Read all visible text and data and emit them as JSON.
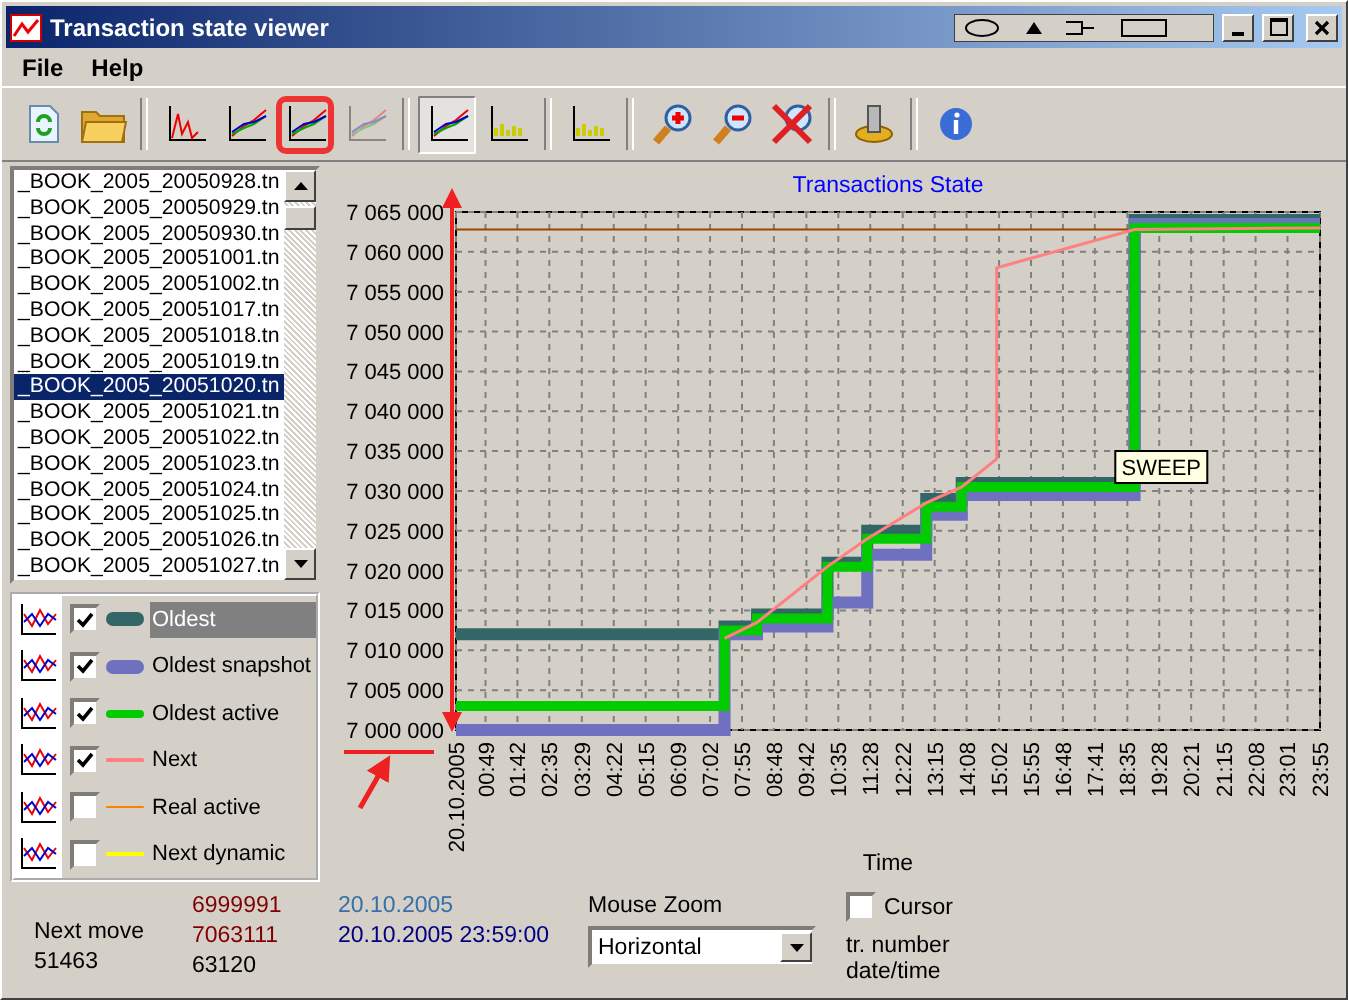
{
  "window": {
    "title": "Transaction state viewer"
  },
  "menu": [
    "File",
    "Help"
  ],
  "toolbar": [
    {
      "kind": "refresh",
      "pressed": false,
      "disabled": false,
      "highlighted": false
    },
    {
      "kind": "open",
      "pressed": false,
      "disabled": false,
      "highlighted": false
    },
    {
      "kind": "separator"
    },
    {
      "kind": "spikes",
      "pressed": false,
      "disabled": false,
      "highlighted": false
    },
    {
      "kind": "lines",
      "pressed": false,
      "disabled": false,
      "highlighted": false
    },
    {
      "kind": "lines",
      "pressed": false,
      "disabled": false,
      "highlighted": true
    },
    {
      "kind": "lines",
      "pressed": false,
      "disabled": true,
      "highlighted": false
    },
    {
      "kind": "separator"
    },
    {
      "kind": "lines",
      "pressed": true,
      "disabled": false,
      "highlighted": false
    },
    {
      "kind": "bars",
      "pressed": false,
      "disabled": false,
      "highlighted": false
    },
    {
      "kind": "separator"
    },
    {
      "kind": "bars",
      "pressed": false,
      "disabled": false,
      "highlighted": false
    },
    {
      "kind": "separator"
    },
    {
      "kind": "zoomin",
      "pressed": false,
      "disabled": false,
      "highlighted": false
    },
    {
      "kind": "zoomout",
      "pressed": false,
      "disabled": false,
      "highlighted": false
    },
    {
      "kind": "zoomreset",
      "pressed": false,
      "disabled": false,
      "highlighted": false
    },
    {
      "kind": "separator"
    },
    {
      "kind": "settings",
      "pressed": false,
      "disabled": false,
      "highlighted": false
    },
    {
      "kind": "separator"
    },
    {
      "kind": "info",
      "pressed": false,
      "disabled": false,
      "highlighted": false
    }
  ],
  "files": [
    {
      "name": "_BOOK_2005_20050928.tn",
      "selected": false
    },
    {
      "name": "_BOOK_2005_20050929.tn",
      "selected": false
    },
    {
      "name": "_BOOK_2005_20050930.tn",
      "selected": false
    },
    {
      "name": "_BOOK_2005_20051001.tn",
      "selected": false
    },
    {
      "name": "_BOOK_2005_20051002.tn",
      "selected": false
    },
    {
      "name": "_BOOK_2005_20051017.tn",
      "selected": false
    },
    {
      "name": "_BOOK_2005_20051018.tn",
      "selected": false
    },
    {
      "name": "_BOOK_2005_20051019.tn",
      "selected": false
    },
    {
      "name": "_BOOK_2005_20051020.tn",
      "selected": true
    },
    {
      "name": "_BOOK_2005_20051021.tn",
      "selected": false
    },
    {
      "name": "_BOOK_2005_20051022.tn",
      "selected": false
    },
    {
      "name": "_BOOK_2005_20051023.tn",
      "selected": false
    },
    {
      "name": "_BOOK_2005_20051024.tn",
      "selected": false
    },
    {
      "name": "_BOOK_2005_20051025.tn",
      "selected": false
    },
    {
      "name": "_BOOK_2005_20051026.tn",
      "selected": false
    },
    {
      "name": "_BOOK_2005_20051027.tn",
      "selected": false
    }
  ],
  "legend": [
    {
      "checked": true,
      "selected": true,
      "kind": "thick"
    },
    {
      "checked": true,
      "selected": false,
      "kind": "thick"
    },
    {
      "checked": true,
      "selected": false,
      "kind": "medium"
    },
    {
      "checked": true,
      "selected": false,
      "kind": "thin"
    },
    {
      "label": "Real active",
      "checked": false,
      "selected": false,
      "color": "#ff8000",
      "kind": "thin"
    },
    {
      "label": "Next dynamic",
      "checked": false,
      "selected": false,
      "color": "#ffff00",
      "kind": "thin"
    }
  ],
  "chart_data": {
    "type": "line",
    "title": "Transactions State",
    "xlabel": "Time",
    "grid": true,
    "x": [
      0,
      446,
      446,
      500,
      500,
      617,
      617,
      683,
      683,
      781,
      781,
      840,
      840,
      898,
      898,
      1127,
      1127,
      1435
    ],
    "xlim": [
      0,
      1435
    ],
    "xticks": [
      {
        "value": 0,
        "label": "20.10.2005"
      },
      {
        "value": 49,
        "label": "00:49"
      },
      {
        "value": 102,
        "label": "01:42"
      },
      {
        "value": 155,
        "label": "02:35"
      },
      {
        "value": 209,
        "label": "03:29"
      },
      {
        "value": 262,
        "label": "04:22"
      },
      {
        "value": 315,
        "label": "05:15"
      },
      {
        "value": 369,
        "label": "06:09"
      },
      {
        "value": 422,
        "label": "07:02"
      },
      {
        "value": 475,
        "label": "07:55"
      },
      {
        "value": 528,
        "label": "08:48"
      },
      {
        "value": 582,
        "label": "09:42"
      },
      {
        "value": 635,
        "label": "10:35"
      },
      {
        "value": 688,
        "label": "11:28"
      },
      {
        "value": 742,
        "label": "12:22"
      },
      {
        "value": 795,
        "label": "13:15"
      },
      {
        "value": 848,
        "label": "14:08"
      },
      {
        "value": 902,
        "label": "15:02"
      },
      {
        "value": 955,
        "label": "15:55"
      },
      {
        "value": 1008,
        "label": "16:48"
      },
      {
        "value": 1061,
        "label": "17:41"
      },
      {
        "value": 1115,
        "label": "18:35"
      },
      {
        "value": 1168,
        "label": "19:28"
      },
      {
        "value": 1221,
        "label": "20:21"
      },
      {
        "value": 1275,
        "label": "21:15"
      },
      {
        "value": 1328,
        "label": "22:08"
      },
      {
        "value": 1381,
        "label": "23:01"
      },
      {
        "value": 1435,
        "label": "23:55"
      }
    ],
    "ylim": [
      7000000,
      7065000
    ],
    "yticks": [
      {
        "value": 7000000,
        "label": "7 000 000"
      },
      {
        "value": 7005000,
        "label": "7 005 000"
      },
      {
        "value": 7010000,
        "label": "7 010 000"
      },
      {
        "value": 7015000,
        "label": "7 015 000"
      },
      {
        "value": 7020000,
        "label": "7 020 000"
      },
      {
        "value": 7025000,
        "label": "7 025 000"
      },
      {
        "value": 7030000,
        "label": "7 030 000"
      },
      {
        "value": 7035000,
        "label": "7 035 000"
      },
      {
        "value": 7040000,
        "label": "7 040 000"
      },
      {
        "value": 7045000,
        "label": "7 045 000"
      },
      {
        "value": 7050000,
        "label": "7 050 000"
      },
      {
        "value": 7055000,
        "label": "7 055 000"
      },
      {
        "value": 7060000,
        "label": "7 060 000"
      },
      {
        "value": 7065000,
        "label": "7 065 000"
      }
    ],
    "series": [
      {
        "name": "Oldest",
        "color": "#336666",
        "values": [
          7012000,
          7012000,
          7013000,
          7013000,
          7014500,
          7014500,
          7021000,
          7021000,
          7025000,
          7025000,
          7029000,
          7029000,
          7031000,
          7031000,
          7031000,
          7031000,
          7064000,
          7064000
        ]
      },
      {
        "name": "Oldest snapshot",
        "color": "#7070c0",
        "values": [
          7000000,
          7000000,
          7012000,
          7012000,
          7013000,
          7013000,
          7016000,
          7016000,
          7022000,
          7022000,
          7027000,
          7027000,
          7029500,
          7029500,
          7029500,
          7029500,
          7063500,
          7063500
        ]
      },
      {
        "name": "Oldest active",
        "color": "#00cc00",
        "values": [
          7003000,
          7003000,
          7012500,
          7012500,
          7014000,
          7014000,
          7020500,
          7020500,
          7024000,
          7024000,
          7028000,
          7028000,
          7030500,
          7030500,
          7030500,
          7030500,
          7063000,
          7063000
        ]
      },
      {
        "name": "Next",
        "color": "#ff8080",
        "values": [
          null,
          7011500,
          7011500,
          7013500,
          7013500,
          7020500,
          7020500,
          7024000,
          7024000,
          7028500,
          7028500,
          7030500,
          7030500,
          7034000,
          7058000,
          7062800,
          7062800,
          7063000
        ]
      }
    ],
    "ref_lines": [
      {
        "axis": "y",
        "value": 7062800,
        "color": "#994400"
      }
    ],
    "annotations": [
      "SWEEP"
    ]
  },
  "status": {
    "next_move_label": "Next move",
    "next_move": "51463",
    "min_number": "6999991",
    "max_number": "7063111",
    "count": "63120",
    "start_date": "20.10.2005",
    "end_date": "20.10.2005 23:59:00",
    "zoom_label": "Mouse Zoom",
    "zoom_value": "Horizontal",
    "cursor_label": "Cursor",
    "cursor_checked": false,
    "cursor_hint_1": "tr. number",
    "cursor_hint_2": "date/time"
  }
}
